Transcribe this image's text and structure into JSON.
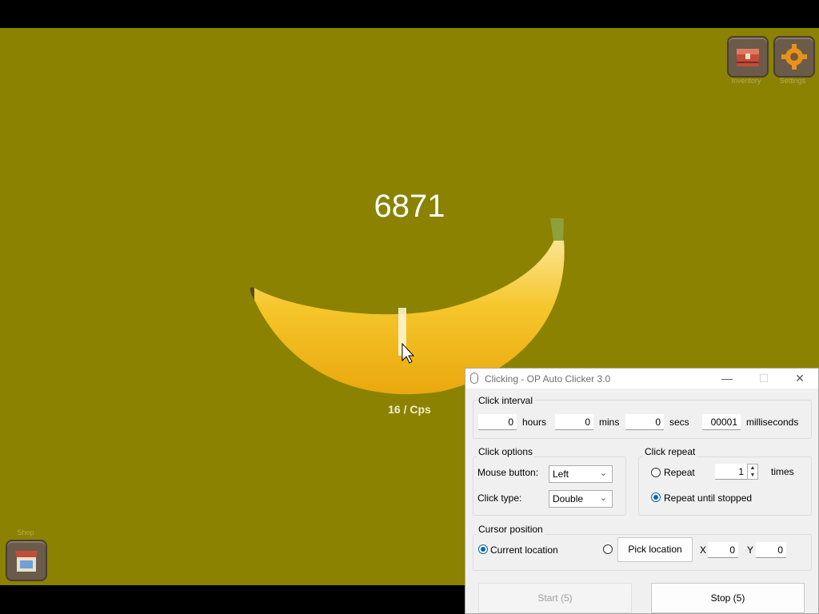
{
  "game": {
    "counter": "6871",
    "cps": "16 / Cps",
    "inventory_label": "Inventory",
    "settings_label": "Settings",
    "shop_label": "Shop",
    "colors": {
      "background": "#8a8200",
      "counter": "#ffffff"
    }
  },
  "window": {
    "title": "Clicking - OP Auto Clicker 3.0",
    "click_interval": {
      "label": "Click interval",
      "hours_value": "0",
      "hours_unit": "hours",
      "mins_value": "0",
      "mins_unit": "mins",
      "secs_value": "0",
      "secs_unit": "secs",
      "ms_value": "00001",
      "ms_unit": "milliseconds"
    },
    "click_options": {
      "label": "Click options",
      "mouse_button_label": "Mouse button:",
      "mouse_button_value": "Left",
      "click_type_label": "Click type:",
      "click_type_value": "Double"
    },
    "click_repeat": {
      "label": "Click repeat",
      "repeat_label": "Repeat",
      "repeat_times_value": "1",
      "times_label": "times",
      "repeat_until_stopped_label": "Repeat until stopped",
      "selected": "repeat_until_stopped"
    },
    "cursor_position": {
      "label": "Cursor position",
      "current_location_label": "Current location",
      "pick_location_label": "Pick location",
      "x_label": "X",
      "x_value": "0",
      "y_label": "Y",
      "y_value": "0",
      "selected": "current_location"
    },
    "start_label": "Start (5)",
    "stop_label": "Stop (5)"
  }
}
